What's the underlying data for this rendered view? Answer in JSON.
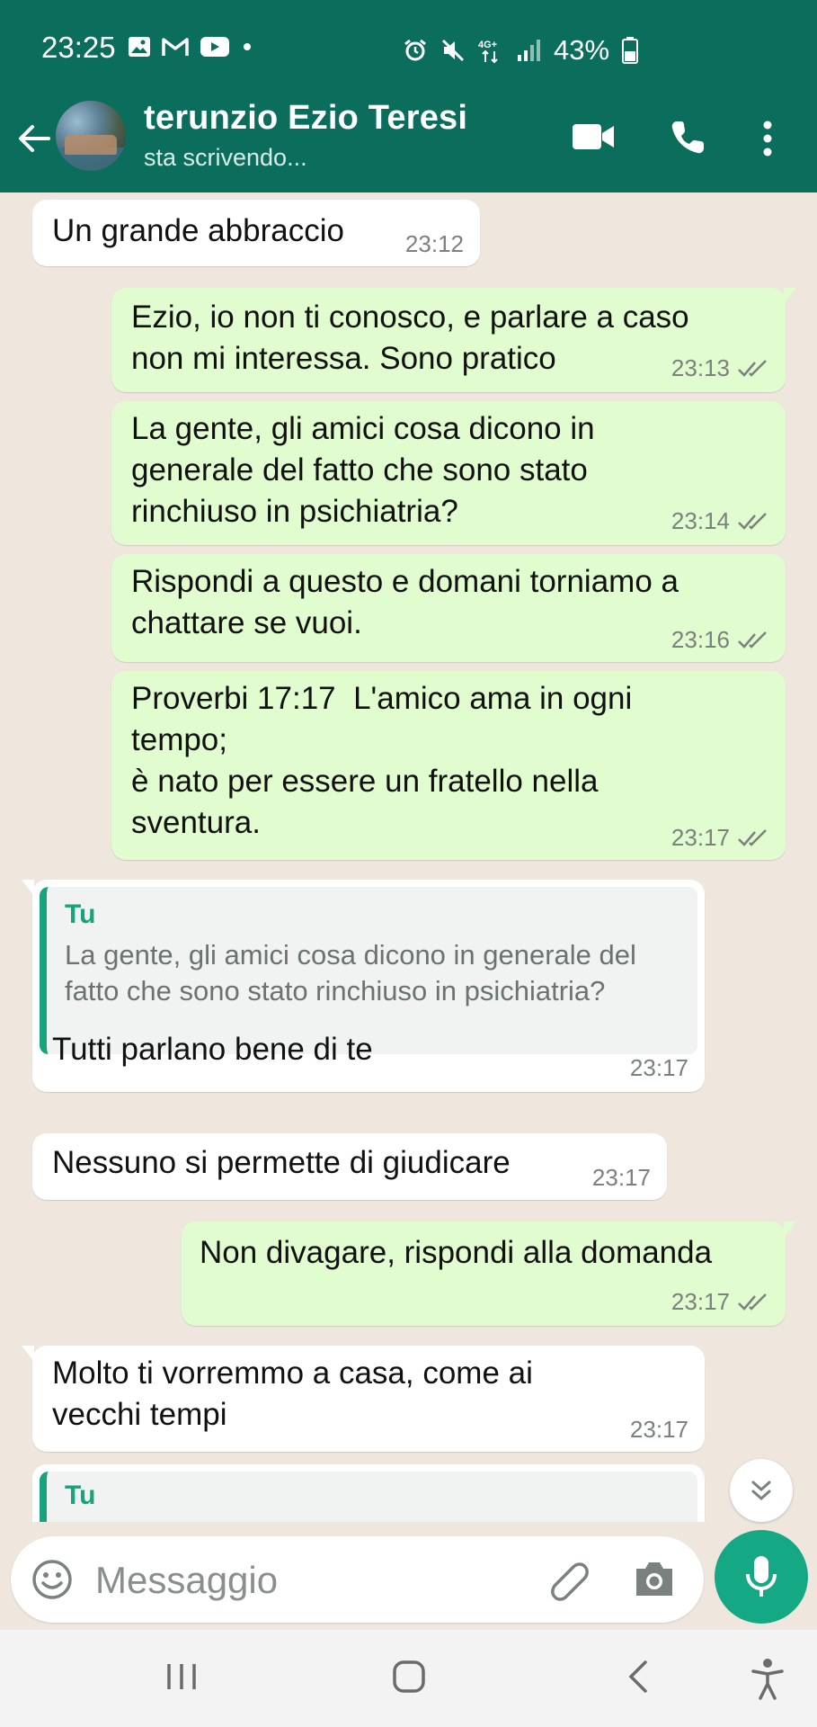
{
  "status_bar": {
    "time": "23:25",
    "battery": "43%",
    "network": "4G+"
  },
  "header": {
    "contact_name": "terunzio Ezio Teresi",
    "status": "sta scrivendo...",
    "icons": [
      "back-arrow-icon",
      "video-call-icon",
      "voice-call-icon",
      "more-options-icon"
    ]
  },
  "messages": [
    {
      "dir": "in",
      "text": "Un grande abbraccio",
      "time": "23:12"
    },
    {
      "dir": "out",
      "text": "Ezio, io non ti conosco, e parlare a caso\nnon mi interessa. Sono pratico",
      "time": "23:13",
      "read": true
    },
    {
      "dir": "out",
      "text": "La gente, gli amici cosa dicono in\ngenerale del fatto che sono stato\nrinchiuso in psichiatria?",
      "time": "23:14",
      "read": true
    },
    {
      "dir": "out",
      "text": "Rispondi a questo e domani torniamo a\nchattare se vuoi.",
      "time": "23:16",
      "read": true
    },
    {
      "dir": "out",
      "text": "Proverbi 17:17  L'amico ama in ogni\ntempo;\nè nato per essere un fratello nella\nsventura.",
      "time": "23:17",
      "read": true
    },
    {
      "dir": "in",
      "quote_author": "Tu",
      "quote_text": "La gente, gli amici cosa dicono in generale del fatto che sono stato rinchiuso in psichiatria?",
      "text": "Tutti parlano bene di te",
      "time": "23:17"
    },
    {
      "dir": "in",
      "text": "Nessuno si permette di giudicare",
      "time": "23:17"
    },
    {
      "dir": "out",
      "text": "Non divagare, rispondi alla domanda",
      "time": "23:17",
      "read": true
    },
    {
      "dir": "in",
      "text": "Molto ti vorremmo a casa, come ai\nvecchi tempi",
      "time": "23:17"
    },
    {
      "dir": "in",
      "quote_author": "Tu",
      "partial": true
    }
  ],
  "composer": {
    "placeholder": "Messaggio"
  },
  "colors": {
    "header": "#0b6e5c",
    "outgoing_bubble": "#e1fcce",
    "incoming_bubble": "#ffffff",
    "accent": "#14a884",
    "chat_bg": "#efe7de"
  }
}
